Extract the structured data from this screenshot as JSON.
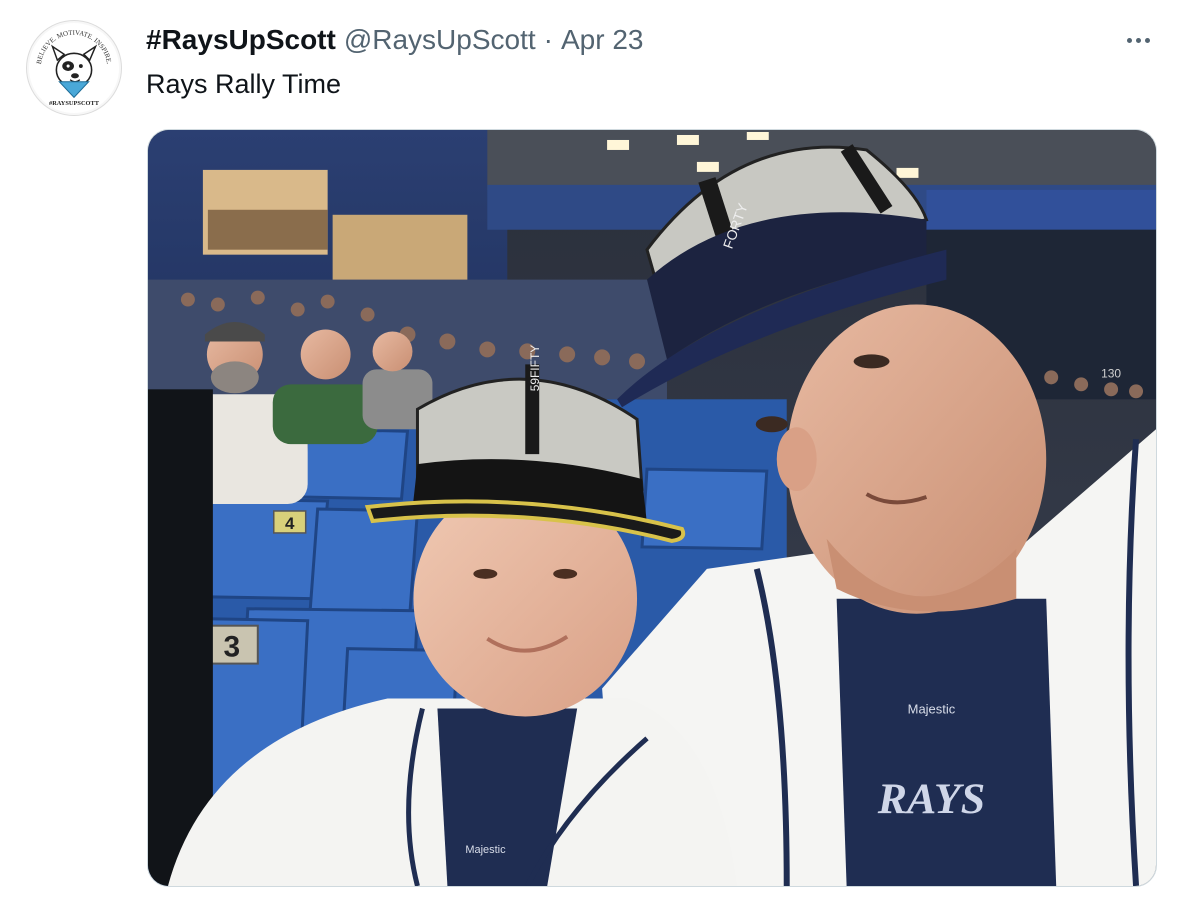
{
  "tweet": {
    "display_name": "#RaysUpScott",
    "handle": "@RaysUpScott",
    "separator": "·",
    "date": "Apr 23",
    "text": "Rays Rally Time",
    "more_icon": "more-horizontal-icon",
    "avatar": {
      "icon": "dog-avatar-logo",
      "logo_text_top": "BELIEVE. MOTIVATE. INSPIRE.",
      "logo_text_bottom": "#RAYSUPSCOTT"
    },
    "photo": {
      "description_icon": "photo-image",
      "hat_text_left": "59FIFTY",
      "hat_text_right": "FORTY",
      "seat_number_1": "3",
      "seat_number_2": "4",
      "section_number": "130",
      "shirt_brand": "Majestic",
      "shirt_text": "RAYS",
      "kid_shirt_brand": "Majestic"
    }
  },
  "colors": {
    "text_primary": "#0f1419",
    "text_secondary": "#536471",
    "border": "#cfd9de",
    "seat_blue": "#2f5fa8",
    "navy": "#1c2a4f"
  }
}
